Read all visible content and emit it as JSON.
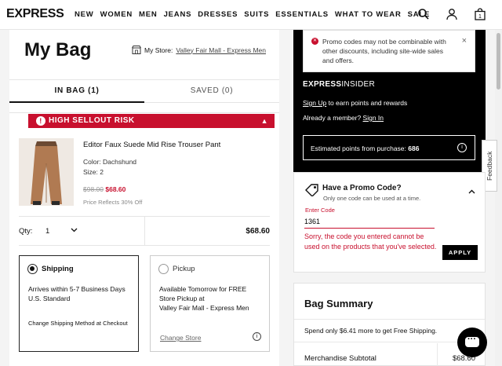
{
  "header": {
    "logo": "EXPRESS",
    "nav": [
      "NEW",
      "WOMEN",
      "MEN",
      "JEANS",
      "DRESSES",
      "SUITS",
      "ESSENTIALS",
      "WHAT TO WEAR",
      "SALE"
    ],
    "bag_count": "1"
  },
  "page": {
    "title": "My Bag",
    "store_label": "My Store:",
    "store_name": "Valley Fair Mall - Express Men"
  },
  "tabs": {
    "in_bag": "IN BAG (1)",
    "saved": "SAVED (0)"
  },
  "item": {
    "risk_label": "HIGH SELLOUT RISK",
    "name": "Editor Faux Suede Mid Rise Trouser Pant",
    "color": "Color: Dachshund",
    "size": "Size: 2",
    "orig_price": "$98.00",
    "sale_price": "$68.60",
    "price_note": "Price Reflects 30% Off",
    "qty_label": "Qty:",
    "qty_value": "1",
    "line_total": "$68.60"
  },
  "shipping": {
    "label": "Shipping",
    "line1": "Arrives within 5-7 Business Days",
    "line2": "U.S. Standard",
    "change": "Change Shipping Method at Checkout"
  },
  "pickup": {
    "label": "Pickup",
    "line1": "Available Tomorrow for FREE Store Pickup at",
    "line2": "Valley Fair Mall - Express Men",
    "change": "Change Store"
  },
  "notice": {
    "text": "Promo codes may not be combinable with other discounts, including site-wide sales and offers."
  },
  "insider": {
    "brand_bold": "EXPRESS",
    "brand_rest": "INSIDER",
    "signup_link": "Sign Up",
    "signup_rest": " to earn points and rewards",
    "member_text": "Already a member? ",
    "signin_link": "Sign In",
    "points_label": "Estimated points from purchase: ",
    "points_value": "686"
  },
  "feedback": "Feedback",
  "promo": {
    "title": "Have a Promo Code?",
    "subtitle": "Only one code can be used at a time.",
    "field_label": "Enter Code",
    "code_value": "1361",
    "error": "Sorry, the code you entered cannot be used on the products that you've selected.",
    "apply": "APPLY"
  },
  "summary": {
    "title": "Bag Summary",
    "shipping_msg": "Spend only $6.41 more to get Free Shipping.",
    "subtotal_label": "Merchandise Subtotal",
    "subtotal_value": "$68.60"
  },
  "colors": {
    "accent_red": "#c8102e",
    "black": "#000000"
  }
}
